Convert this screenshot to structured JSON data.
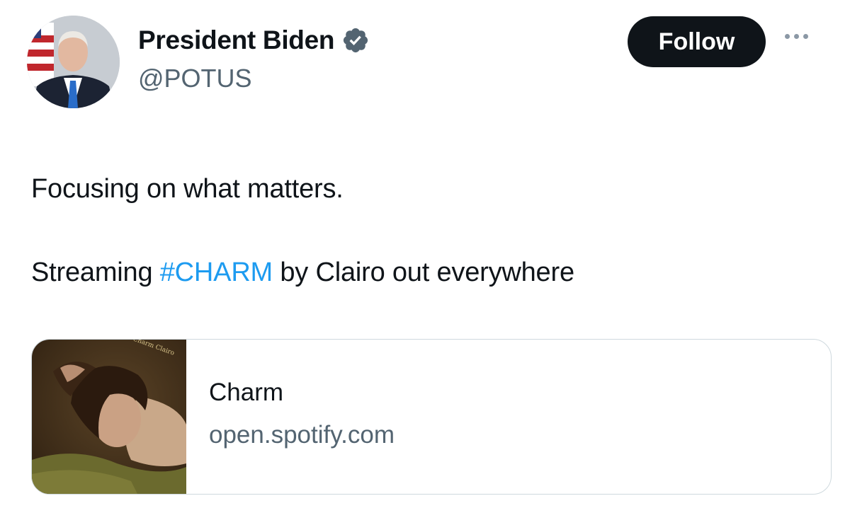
{
  "tweet": {
    "author": {
      "name": "President Biden",
      "handle": "@POTUS",
      "verified": true,
      "verified_color": "#536471"
    },
    "follow_label": "Follow",
    "more_icon": "more-horizontal-icon",
    "text_line1": "Focusing on what matters.",
    "text_line2_before": "Streaming ",
    "hashtag": "#CHARM",
    "text_line2_after": " by Clairo out everywhere",
    "hashtag_color": "#1d9bf0",
    "card": {
      "title": "Charm",
      "domain": "open.spotify.com",
      "cover_text": "Charm Clairo"
    }
  }
}
